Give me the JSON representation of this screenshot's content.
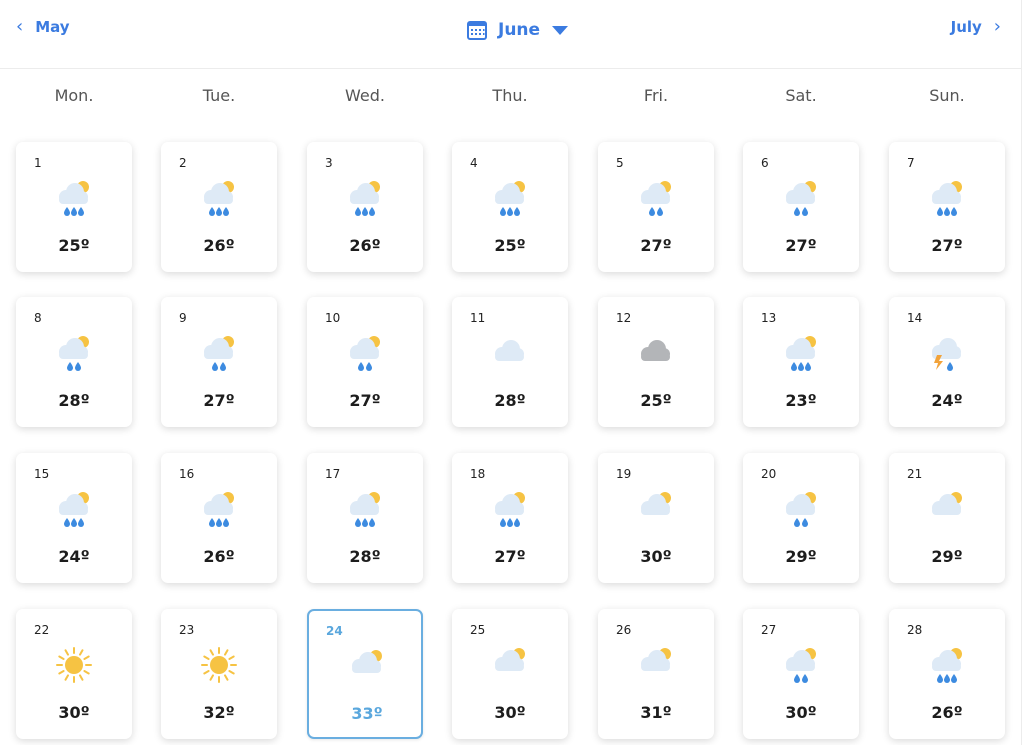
{
  "nav": {
    "prev_label": "May",
    "next_label": "July",
    "current_month": "June"
  },
  "weekdays": [
    "Mon.",
    "Tue.",
    "Wed.",
    "Thu.",
    "Fri.",
    "Sat.",
    "Sun."
  ],
  "colors": {
    "accent": "#3b7be0",
    "selected": "#5aa7dd",
    "sun": "#f6c343",
    "rain": "#3d8be0",
    "cloud": "#deeaf6",
    "dark_cloud": "#b3b5b8",
    "lightning": "#f2a33a"
  },
  "days": [
    {
      "day": "1",
      "temp": "25º",
      "icon": "cloud-sun-rain-heavy-icon"
    },
    {
      "day": "2",
      "temp": "26º",
      "icon": "cloud-sun-rain-heavy-icon"
    },
    {
      "day": "3",
      "temp": "26º",
      "icon": "cloud-sun-rain-heavy-icon"
    },
    {
      "day": "4",
      "temp": "25º",
      "icon": "cloud-sun-rain-heavy-icon"
    },
    {
      "day": "5",
      "temp": "27º",
      "icon": "cloud-sun-rain-light-icon"
    },
    {
      "day": "6",
      "temp": "27º",
      "icon": "cloud-sun-rain-light-icon"
    },
    {
      "day": "7",
      "temp": "27º",
      "icon": "cloud-sun-rain-heavy-icon"
    },
    {
      "day": "8",
      "temp": "28º",
      "icon": "cloud-sun-rain-light-icon"
    },
    {
      "day": "9",
      "temp": "27º",
      "icon": "cloud-sun-rain-light-icon"
    },
    {
      "day": "10",
      "temp": "27º",
      "icon": "cloud-sun-rain-light-icon"
    },
    {
      "day": "11",
      "temp": "28º",
      "icon": "cloud-icon"
    },
    {
      "day": "12",
      "temp": "25º",
      "icon": "dark-cloud-icon"
    },
    {
      "day": "13",
      "temp": "23º",
      "icon": "cloud-sun-rain-heavy-icon"
    },
    {
      "day": "14",
      "temp": "24º",
      "icon": "cloud-lightning-rain-icon"
    },
    {
      "day": "15",
      "temp": "24º",
      "icon": "cloud-sun-rain-heavy-icon"
    },
    {
      "day": "16",
      "temp": "26º",
      "icon": "cloud-sun-rain-heavy-icon"
    },
    {
      "day": "17",
      "temp": "28º",
      "icon": "cloud-sun-rain-heavy-icon"
    },
    {
      "day": "18",
      "temp": "27º",
      "icon": "cloud-sun-rain-heavy-icon"
    },
    {
      "day": "19",
      "temp": "30º",
      "icon": "cloud-sun-icon"
    },
    {
      "day": "20",
      "temp": "29º",
      "icon": "cloud-sun-rain-light-icon"
    },
    {
      "day": "21",
      "temp": "29º",
      "icon": "cloud-sun-icon"
    },
    {
      "day": "22",
      "temp": "30º",
      "icon": "sun-icon"
    },
    {
      "day": "23",
      "temp": "32º",
      "icon": "sun-icon"
    },
    {
      "day": "24",
      "temp": "33º",
      "icon": "cloud-sun-icon",
      "selected": true
    },
    {
      "day": "25",
      "temp": "30º",
      "icon": "cloud-sun-icon"
    },
    {
      "day": "26",
      "temp": "31º",
      "icon": "cloud-sun-icon"
    },
    {
      "day": "27",
      "temp": "30º",
      "icon": "cloud-sun-rain-light-icon"
    },
    {
      "day": "28",
      "temp": "26º",
      "icon": "cloud-sun-rain-heavy-icon"
    }
  ]
}
